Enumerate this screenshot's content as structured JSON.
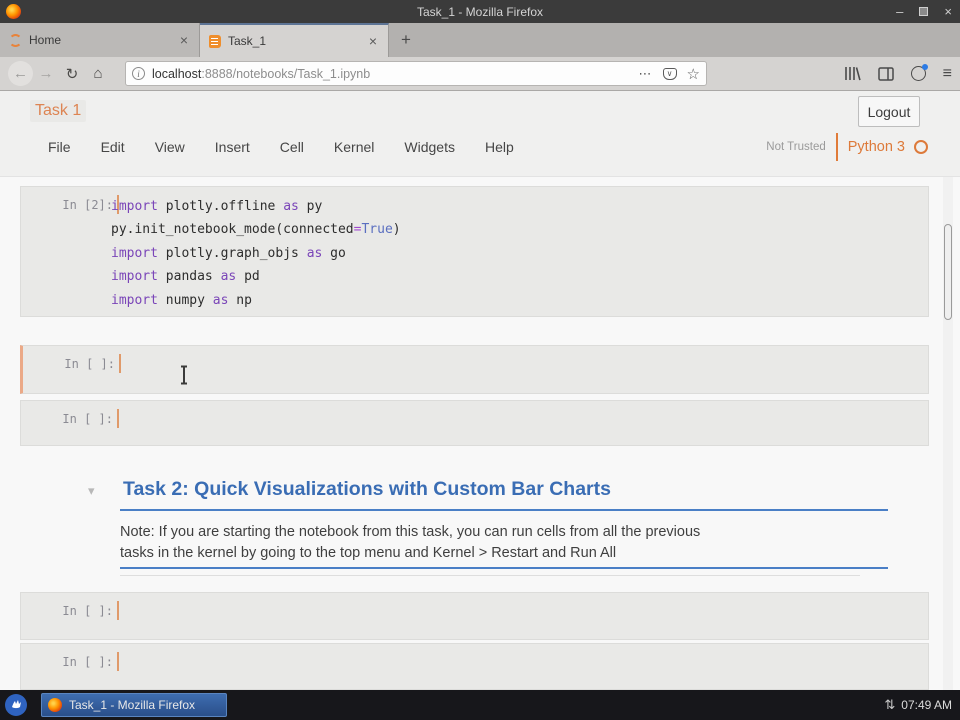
{
  "colors": {
    "jupyter_orange": "#dd7a3a",
    "heading_blue": "#3a6db4",
    "rule_blue": "#4a7fc6",
    "selected_cell_accent": "#eba987",
    "keyword_purple": "#7a45b8",
    "operator_purple": "#a14ad0",
    "bool_blue": "#5b6fc0",
    "taskbar_button_blue": "#3e6db0",
    "titlebar_gray": "#3b3b3b"
  },
  "titlebar": {
    "title": "Task_1 - Mozilla Firefox",
    "minimize_glyph": "–",
    "close_glyph": "×"
  },
  "browser": {
    "tabs": [
      {
        "label": "Home"
      },
      {
        "label": "Task_1"
      }
    ],
    "tab_close_glyph": "×",
    "new_tab_glyph": "+",
    "back_glyph": "←",
    "forward_glyph": "→",
    "reload_glyph": "↻",
    "home_glyph": "⌂",
    "info_glyph": "i",
    "url": {
      "host": "localhost",
      "path": ":8888/notebooks/Task_1.ipynb"
    },
    "page_action_dots": "⋯",
    "pocket_glyph": "∨",
    "bookmark_star": "☆",
    "menu_glyph": "≡"
  },
  "jupyter": {
    "title": "Task 1",
    "logout_label": "Logout",
    "menu": [
      "File",
      "Edit",
      "View",
      "Insert",
      "Cell",
      "Kernel",
      "Widgets",
      "Help"
    ],
    "trust_status": "Not Trusted",
    "kernel_name": "Python 3"
  },
  "notebook": {
    "code_cell": {
      "prompt": "In [2]:",
      "lines": [
        [
          {
            "t": "import",
            "c": "kw"
          },
          {
            "t": " plotly.offline ",
            "c": "tx"
          },
          {
            "t": "as",
            "c": "kw"
          },
          {
            "t": " py",
            "c": "tx"
          }
        ],
        [
          {
            "t": "py.init_notebook_mode(connected",
            "c": "tx"
          },
          {
            "t": "=",
            "c": "op"
          },
          {
            "t": "True",
            "c": "bool"
          },
          {
            "t": ")",
            "c": "tx"
          }
        ],
        [
          {
            "t": "import",
            "c": "kw"
          },
          {
            "t": " plotly.graph_objs ",
            "c": "tx"
          },
          {
            "t": "as",
            "c": "kw"
          },
          {
            "t": " go",
            "c": "tx"
          }
        ],
        [
          {
            "t": "import",
            "c": "kw"
          },
          {
            "t": " pandas ",
            "c": "tx"
          },
          {
            "t": "as",
            "c": "kw"
          },
          {
            "t": " pd",
            "c": "tx"
          }
        ],
        [
          {
            "t": "import",
            "c": "kw"
          },
          {
            "t": " numpy ",
            "c": "tx"
          },
          {
            "t": "as",
            "c": "kw"
          },
          {
            "t": " np",
            "c": "tx"
          }
        ]
      ]
    },
    "empty_prompt": "In [ ]:",
    "markdown": {
      "collapse_arrow": "▾",
      "heading": "Task 2: Quick Visualizations with Custom Bar Charts",
      "note_lines": [
        "Note: If you are starting the notebook from this task, you can run cells from all the previous",
        "tasks in the kernel by going to the top menu and Kernel > Restart and Run All"
      ]
    }
  },
  "taskbar": {
    "window_label": "Task_1 - Mozilla Firefox",
    "network_glyph": "⇅",
    "time": "07:49 AM"
  }
}
